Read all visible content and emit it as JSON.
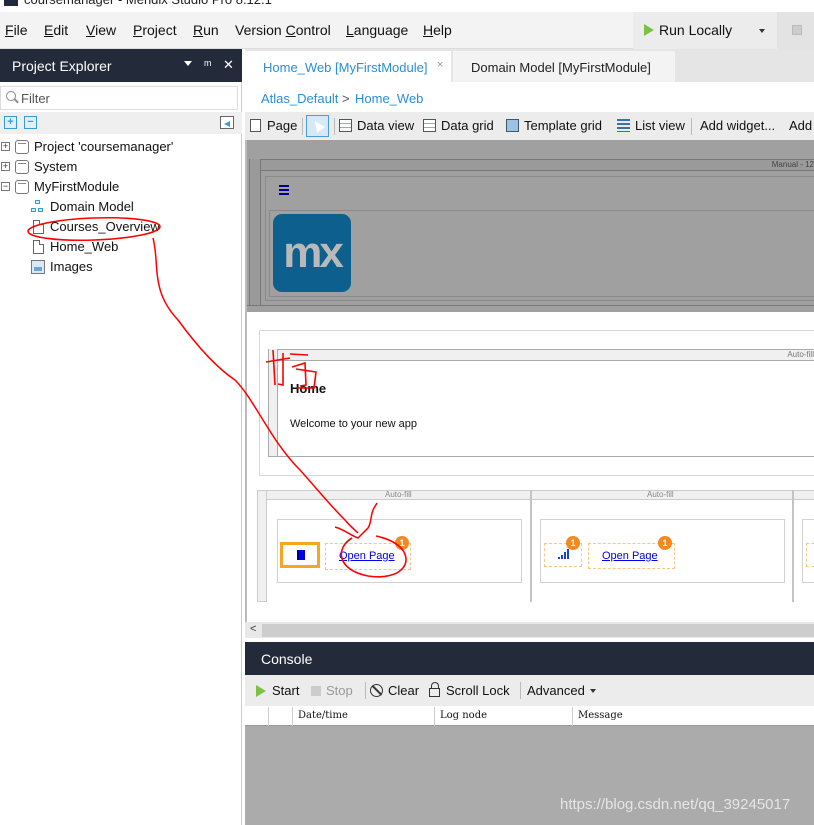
{
  "window": {
    "title": "coursemanager - Mendix Studio Pro 8.12.1"
  },
  "menubar": {
    "items": [
      {
        "label": "File",
        "mnemonic": "F",
        "rest": "ile"
      },
      {
        "label": "Edit",
        "mnemonic": "E",
        "rest": "dit"
      },
      {
        "label": "View",
        "mnemonic": "V",
        "rest": "iew"
      },
      {
        "label": "Project",
        "mnemonic": "P",
        "rest": "roject"
      },
      {
        "label": "Run",
        "mnemonic": "R",
        "rest": "un"
      },
      {
        "label": "Version Control",
        "pre": "Version ",
        "mnemonic": "C",
        "rest": "ontrol"
      },
      {
        "label": "Language",
        "mnemonic": "L",
        "rest": "anguage"
      },
      {
        "label": "Help",
        "mnemonic": "H",
        "rest": "elp"
      }
    ],
    "run_locally": "Run Locally"
  },
  "explorer": {
    "title": "Project Explorer",
    "filter_placeholder": "Filter",
    "tree": [
      {
        "label": "Project 'coursemanager'",
        "icon": "project-icon",
        "toggle": "+"
      },
      {
        "label": "System",
        "icon": "module-icon",
        "toggle": "+"
      },
      {
        "label": "MyFirstModule",
        "icon": "module-icon",
        "toggle": "-"
      },
      {
        "label": "Domain Model",
        "icon": "domain-model-icon"
      },
      {
        "label": "Courses_Overview",
        "icon": "page-icon"
      },
      {
        "label": "Home_Web",
        "icon": "page-icon"
      },
      {
        "label": "Images",
        "icon": "images-icon"
      }
    ]
  },
  "editor": {
    "tabs": [
      {
        "label": "Home_Web [MyFirstModule]",
        "active": true,
        "close": "×"
      },
      {
        "label": "Domain Model [MyFirstModule]",
        "active": false
      }
    ],
    "breadcrumb": [
      "Atlas_Default",
      ">",
      "Home_Web"
    ],
    "toolbar": {
      "page": "Page",
      "data_view": "Data view",
      "data_grid": "Data grid",
      "template_grid": "Template grid",
      "list_view": "List view",
      "add_widget": "Add widget...",
      "add_more": "Add"
    }
  },
  "canvas": {
    "layout_ruler_label": "Manual - 12",
    "logo_text": "mx",
    "home_ruler_label": "Auto-fill",
    "home_title": "Home",
    "home_subtitle": "Welcome to your new app",
    "columns": [
      {
        "ruler_label": "Auto-fill",
        "link": "Open Page",
        "link_badge": "1",
        "icon": "book-icon"
      },
      {
        "ruler_label": "Auto-fill",
        "link": "Open Page",
        "link_badge": "1",
        "icon": "signal-icon",
        "icon_badge": "1"
      }
    ]
  },
  "console": {
    "title": "Console",
    "start": "Start",
    "stop": "Stop",
    "clear": "Clear",
    "scroll_lock": "Scroll Lock",
    "advanced": "Advanced",
    "columns": [
      "Date/time",
      "Log node",
      "Message"
    ]
  },
  "annotation": {
    "handwritten_text": "拖",
    "color": "#ff0000"
  },
  "watermark": "https://blog.csdn.net/qq_39245017"
}
